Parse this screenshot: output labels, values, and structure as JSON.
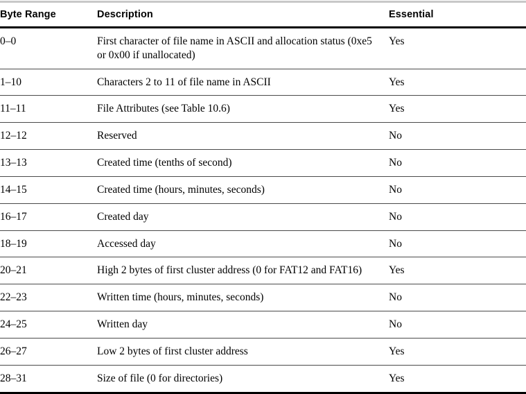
{
  "table": {
    "columns": [
      {
        "key": "byte_range",
        "label": "Byte Range"
      },
      {
        "key": "description",
        "label": "Description"
      },
      {
        "key": "essential",
        "label": "Essential"
      }
    ],
    "rows": [
      {
        "byte_range": "0–0",
        "description": "First character of file name in ASCII and allocation status (0xe5 or 0x00 if unallocated)",
        "essential": "Yes"
      },
      {
        "byte_range": "1–10",
        "description": "Characters 2 to 11 of file name in ASCII",
        "essential": "Yes"
      },
      {
        "byte_range": "11–11",
        "description": "File Attributes (see Table 10.6)",
        "essential": "Yes"
      },
      {
        "byte_range": "12–12",
        "description": "Reserved",
        "essential": "No"
      },
      {
        "byte_range": "13–13",
        "description": "Created time (tenths of second)",
        "essential": "No"
      },
      {
        "byte_range": "14–15",
        "description": "Created time (hours, minutes, seconds)",
        "essential": "No"
      },
      {
        "byte_range": "16–17",
        "description": "Created day",
        "essential": "No"
      },
      {
        "byte_range": "18–19",
        "description": "Accessed day",
        "essential": "No"
      },
      {
        "byte_range": "20–21",
        "description": "High 2 bytes of first cluster address (0 for FAT12 and FAT16)",
        "essential": "Yes"
      },
      {
        "byte_range": "22–23",
        "description": "Written time (hours, minutes, seconds)",
        "essential": "No"
      },
      {
        "byte_range": "24–25",
        "description": "Written day",
        "essential": "No"
      },
      {
        "byte_range": "26–27",
        "description": "Low 2 bytes of first cluster address",
        "essential": "Yes"
      },
      {
        "byte_range": "28–31",
        "description": "Size of file (0 for directories)",
        "essential": "Yes"
      }
    ]
  },
  "style": {
    "page_background": "#ffffff",
    "text_color": "#000000",
    "top_rule_color": "#c8c8c8",
    "header_rule_color": "#000000",
    "row_rule_color": "#4a4a4a",
    "bottom_rule_color": "#000000"
  }
}
